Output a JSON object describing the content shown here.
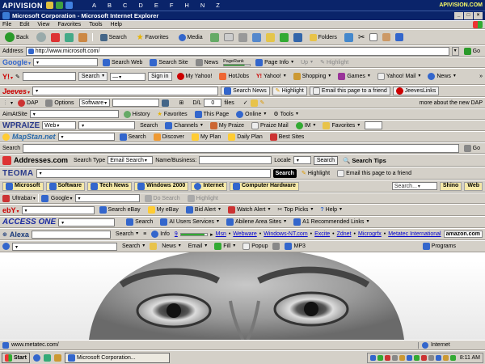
{
  "title_bar": {
    "app": "Microsoft Corporation - Microsoft Internet Explorer",
    "brand": "APIVISION",
    "site": "APIVISION.COM"
  },
  "menu": [
    "File",
    "Edit",
    "View",
    "Favorites",
    "Tools",
    "Help"
  ],
  "toolbar": {
    "back": "Back",
    "search": "Search",
    "favorites": "Favorites",
    "media": "Media",
    "folders": "Folders"
  },
  "address": {
    "label": "Address",
    "url": "http://www.microsoft.com/",
    "go": "Go"
  },
  "google_bar": {
    "logo": "Google",
    "search_web": "Search Web",
    "search_site": "Search Site",
    "news": "News",
    "pagerank": "PageRank",
    "page_info": "Page Info",
    "up": "Up",
    "highlight": "Highlight"
  },
  "yahoo_bar": {
    "search": "Search",
    "sign_in": "Sign in",
    "my_yahoo": "My Yahoo!",
    "hotjobs": "HotJobs",
    "yahoo": "Yahoo!",
    "shopping": "Shopping",
    "games": "Games",
    "yahoo_mail": "Yahoo! Mail",
    "news": "News"
  },
  "jeeves_bar": {
    "logo": "Jeeves",
    "search_news": "Search News",
    "highlight": "Highlight",
    "email": "Email this page to a friend",
    "links": "JeevesLinks"
  },
  "dap_bar": {
    "dap": "DAP",
    "options": "Options",
    "software": "Software",
    "dl_label": "D/L",
    "dl_count": "0",
    "files": "files",
    "more": "more about the new DAP"
  },
  "aimat_bar": {
    "label": "AimAtSite",
    "history": "History",
    "favorites": "Favorites",
    "this_page": "This Page",
    "online": "Online",
    "tools": "Tools"
  },
  "wpraize_bar": {
    "logo": "WPRAIZE",
    "web": "Web",
    "search": "Search",
    "channels": "Channels",
    "my_praize": "My Praize",
    "praize_mail": "Praize Mail",
    "im": "IM",
    "favorites": "Favorites"
  },
  "mapstan_bar": {
    "logo": "MapStan.net",
    "search": "Search",
    "discover": "Discover",
    "my_plan": "My Plan",
    "daily_plan": "Daily Plan",
    "best_sites": "Best Sites"
  },
  "search_bar": {
    "label": "Search",
    "go": "Go"
  },
  "addresses_bar": {
    "logo": "Addresses.com",
    "search_type": "Search Type",
    "search_type_value": "Email Search",
    "name_business": "Name/Business:",
    "locale": "Locale",
    "search": "Search",
    "tips": "Search Tips"
  },
  "teoma_bar": {
    "logo": "TEOMA",
    "search": "Search",
    "highlight": "Highlight",
    "email": "Email this page to a friend"
  },
  "links_bar": {
    "items": [
      "Microsoft",
      "Software",
      "Tech News",
      "Windows 2000",
      "Internet",
      "Computer Hardware"
    ],
    "search_placeholder": "Search...",
    "shino": "Shino",
    "web": "Web"
  },
  "ultrabar": {
    "logo": "Ultrabar",
    "google": "Google",
    "do_search": "Do Search",
    "highlight": "Highlight"
  },
  "ebay_bar": {
    "logo": "ebY",
    "search_ebay": "Search eBay",
    "my_ebay": "My eBay",
    "bid_alert": "Bid Alert",
    "watch_alert": "Watch Alert",
    "top_picks": "Top Picks",
    "help": "Help"
  },
  "accessone_bar": {
    "logo": "ACCESS ONE",
    "search": "Search",
    "ai_users": "AI Users Services",
    "abilene": "Abilene Area Sites",
    "a1": "A1 Recommended Links"
  },
  "alexa_bar": {
    "logo": "Alexa",
    "search": "Search",
    "info": "Info",
    "rank": "9",
    "links": [
      "Msn",
      "Webware",
      "Windows-NT.com",
      "Excite",
      "Zdnet",
      "Microgrfx",
      "Metatec International"
    ],
    "amazon": "amazon.com"
  },
  "bottom_bar": {
    "search": "Search",
    "news": "News",
    "email": "Email",
    "fill": "Fill",
    "popup": "Popup",
    "mp3": "MP3",
    "programs": "Programs"
  },
  "status_bar": {
    "url": "www.metatec.com/",
    "zone": "Internet"
  },
  "taskbar": {
    "start": "Start",
    "task": "Microsoft Corporation...",
    "tray_time": "8:11 AM"
  }
}
